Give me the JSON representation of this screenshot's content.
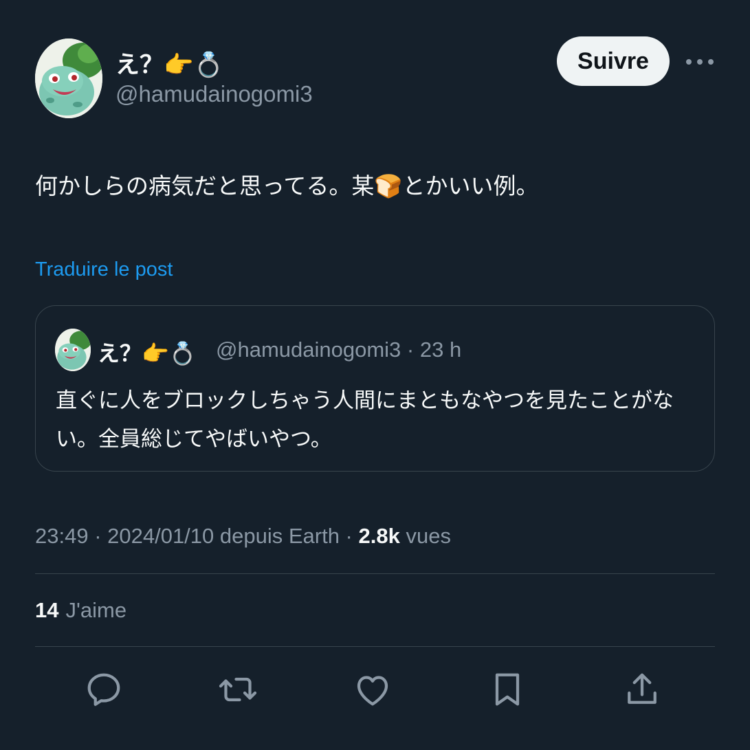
{
  "author": {
    "display_name": "え？👉💍",
    "handle": "@hamudainogomi3",
    "avatar_icon": "bulbasaur-avatar"
  },
  "header": {
    "follow_label": "Suivre",
    "more_icon": "more-horizontal-icon"
  },
  "post": {
    "text": "何かしらの病気だと思ってる。某🍞とかいい例。",
    "translate_label": "Traduire le post"
  },
  "quote": {
    "display_name": "え？👉💍",
    "handle_time": "@hamudainogomi3 · 23 h",
    "text": "直ぐに人をブロックしちゃう人間にまともなやつを見たことがない。全員総じてやばいやつ。"
  },
  "meta": {
    "timestamp": "23:49 · 2024/01/10 depuis Earth · ",
    "views_count": "2.8k",
    "views_label": " vues"
  },
  "likes": {
    "count": "14",
    "label": "J'aime"
  },
  "actions": [
    "reply-icon",
    "repost-icon",
    "like-icon",
    "bookmark-icon",
    "share-icon"
  ],
  "colors": {
    "background": "#15202b",
    "text": "#f7f9f9",
    "muted": "#8b98a5",
    "link": "#1d9bf0",
    "border": "#38444d",
    "follow_bg": "#eff3f4"
  }
}
